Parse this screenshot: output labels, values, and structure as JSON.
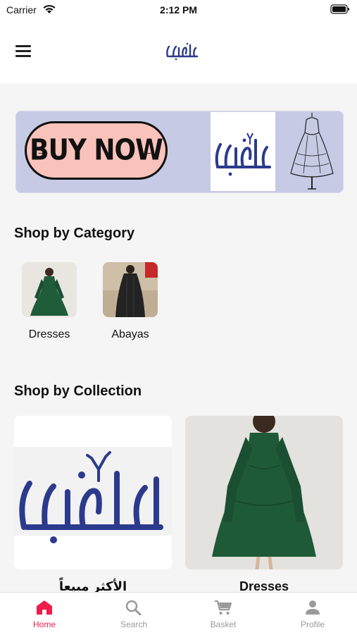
{
  "status_bar": {
    "carrier": "Carrier",
    "time": "2:12 PM"
  },
  "header": {
    "menu_icon": "hamburger-menu-icon",
    "logo": "brand-logo"
  },
  "banner": {
    "cta_text": "BUY NOW",
    "background_color": "#c7cae5",
    "pill_color": "#f9c3bb"
  },
  "shop_by_category": {
    "title": "Shop by Category",
    "items": [
      {
        "label": "Dresses"
      },
      {
        "label": "Abayas"
      }
    ]
  },
  "shop_by_collection": {
    "title": "Shop by Collection",
    "items": [
      {
        "label": "الأكثر مبيعاً"
      },
      {
        "label": "Dresses"
      }
    ]
  },
  "tab_bar": {
    "accent_color": "#ec1c4b",
    "inactive_color": "#9a9a9a",
    "tabs": [
      {
        "label": "Home",
        "icon": "home-icon",
        "active": true
      },
      {
        "label": "Search",
        "icon": "search-icon",
        "active": false
      },
      {
        "label": "Basket",
        "icon": "cart-icon",
        "active": false
      },
      {
        "label": "Profile",
        "icon": "person-icon",
        "active": false
      }
    ]
  }
}
